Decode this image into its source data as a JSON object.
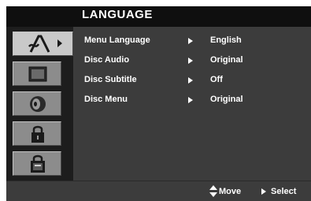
{
  "menu": {
    "title": "LANGUAGE",
    "items": [
      {
        "label": "Menu Language",
        "value": "English"
      },
      {
        "label": "Disc Audio",
        "value": "Original"
      },
      {
        "label": "Disc Subtitle",
        "value": "Off"
      },
      {
        "label": "Disc Menu",
        "value": "Original"
      }
    ]
  },
  "tabs": [
    {
      "icon": "language-icon",
      "active": true
    },
    {
      "icon": "display-icon",
      "active": false
    },
    {
      "icon": "audio-icon",
      "active": false
    },
    {
      "icon": "lock-icon",
      "active": false
    },
    {
      "icon": "others-icon",
      "active": false
    }
  ],
  "footer": {
    "move_label": "Move",
    "select_label": "Select"
  },
  "colors": {
    "panel": "#3c3c3c",
    "tab_active": "#c9c9c9",
    "tab_inactive": "#8c8c8c",
    "text": "#ffffff"
  }
}
